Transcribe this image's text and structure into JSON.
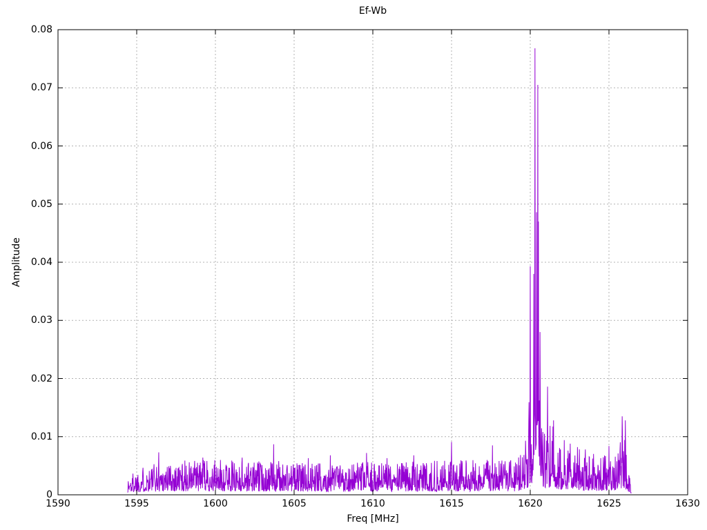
{
  "figure": {
    "background": "#ffffff",
    "axis_color": "#000000",
    "grid_color": "#b0b0b0",
    "text_color": "#000000"
  },
  "chart_data": {
    "type": "line",
    "title": "Ef-Wb",
    "xlabel": "Freq [MHz]",
    "ylabel": "Amplitude",
    "xlim": [
      1590,
      1630
    ],
    "ylim": [
      0,
      0.08
    ],
    "xticks": [
      1590,
      1595,
      1600,
      1605,
      1610,
      1615,
      1620,
      1625,
      1630
    ],
    "xtick_labels": [
      "1590",
      "1595",
      "1600",
      "1605",
      "1610",
      "1615",
      "1620",
      "1625",
      "1630"
    ],
    "yticks": [
      0,
      0.01,
      0.02,
      0.03,
      0.04,
      0.05,
      0.06,
      0.07,
      0.08
    ],
    "ytick_labels": [
      "0",
      "0.01",
      "0.02",
      "0.03",
      "0.04",
      "0.05",
      "0.06",
      "0.07",
      "0.08"
    ],
    "grid": true,
    "grid_style": "dotted",
    "legend_position": "none",
    "line_color": "#9400d3",
    "data_range_mhz": [
      1594.42,
      1626.42
    ],
    "noise": {
      "seed": 1337,
      "step_mhz": 0.02,
      "description": "broadband noise floor, amplitude mostly 0.001-0.006",
      "envelope": [
        [
          1594.42,
          0.003
        ],
        [
          1594.9,
          0.0045
        ],
        [
          1596.0,
          0.0055
        ],
        [
          1598.0,
          0.006
        ],
        [
          1601.0,
          0.006
        ],
        [
          1604.0,
          0.0058
        ],
        [
          1608.0,
          0.0055
        ],
        [
          1612.0,
          0.0058
        ],
        [
          1616.0,
          0.006
        ],
        [
          1619.0,
          0.006
        ],
        [
          1619.75,
          0.008
        ],
        [
          1619.95,
          0.018
        ],
        [
          1620.1,
          0.02
        ],
        [
          1620.55,
          0.02
        ],
        [
          1620.75,
          0.011
        ],
        [
          1621.05,
          0.013
        ],
        [
          1621.45,
          0.012
        ],
        [
          1621.8,
          0.009
        ],
        [
          1622.6,
          0.0085
        ],
        [
          1623.4,
          0.008
        ],
        [
          1624.2,
          0.0068
        ],
        [
          1624.9,
          0.0072
        ],
        [
          1625.5,
          0.008
        ],
        [
          1625.8,
          0.0115
        ],
        [
          1626.1,
          0.009
        ],
        [
          1626.3,
          0.004
        ],
        [
          1626.42,
          0.0008
        ]
      ]
    },
    "peaks": [
      [
        1596.4,
        0.0073
      ],
      [
        1599.2,
        0.0064
      ],
      [
        1601.7,
        0.0064
      ],
      [
        1603.7,
        0.0087
      ],
      [
        1605.9,
        0.0063
      ],
      [
        1607.3,
        0.0068
      ],
      [
        1609.6,
        0.0072
      ],
      [
        1610.9,
        0.0063
      ],
      [
        1612.6,
        0.0068
      ],
      [
        1615.0,
        0.0091
      ],
      [
        1617.6,
        0.0085
      ],
      [
        1619.7,
        0.0093
      ],
      [
        1620.0,
        0.0393
      ],
      [
        1620.22,
        0.038
      ],
      [
        1620.3,
        0.0768
      ],
      [
        1620.39,
        0.0486
      ],
      [
        1620.48,
        0.0705
      ],
      [
        1620.53,
        0.047
      ],
      [
        1620.62,
        0.028
      ],
      [
        1620.9,
        0.0105
      ],
      [
        1621.1,
        0.0186
      ],
      [
        1621.48,
        0.0128
      ],
      [
        1622.16,
        0.0094
      ],
      [
        1622.55,
        0.0088
      ],
      [
        1623.0,
        0.0082
      ],
      [
        1623.5,
        0.0078
      ],
      [
        1625.0,
        0.0084
      ],
      [
        1625.85,
        0.0135
      ],
      [
        1626.05,
        0.0128
      ]
    ],
    "main_peak": {
      "freq_mhz": 1620.3,
      "amplitude": 0.0768
    }
  }
}
